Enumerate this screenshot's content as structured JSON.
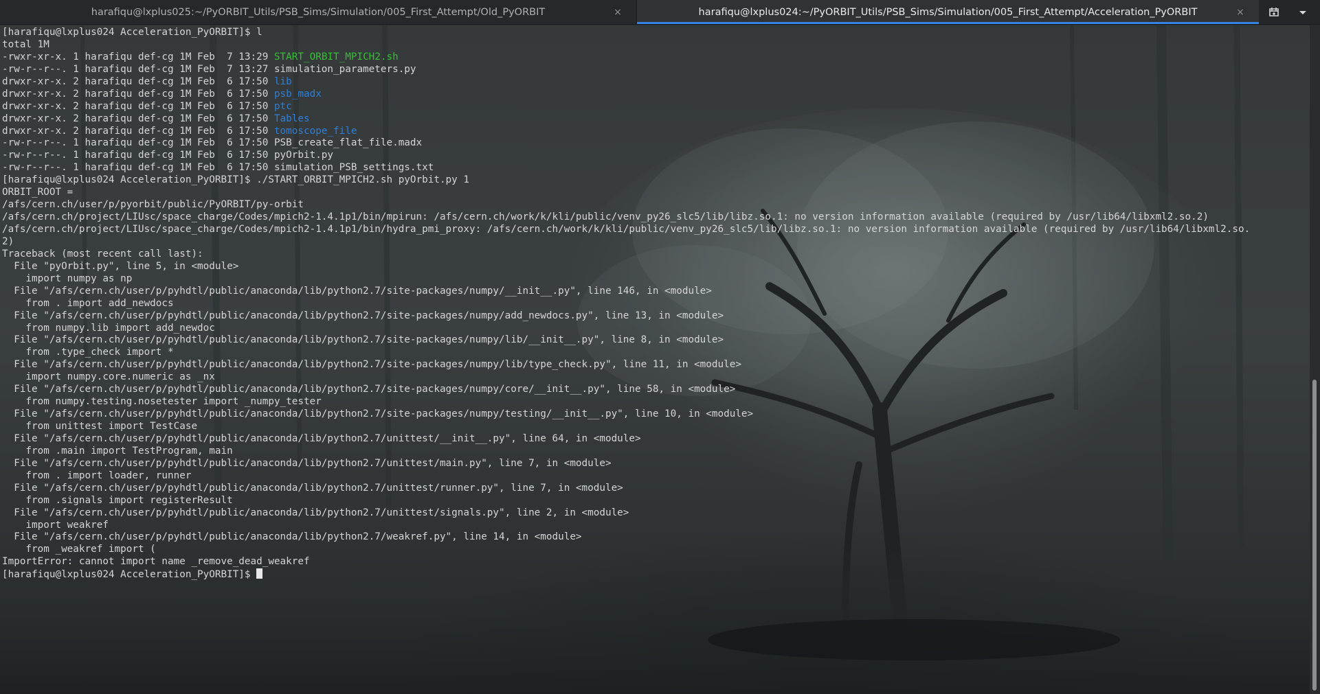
{
  "tabs": [
    {
      "title": "harafiqu@lxplus025:~/PyORBIT_Utils/PSB_Sims/Simulation/005_First_Attempt/Old_PyORBIT",
      "active": false,
      "close_glyph": "×"
    },
    {
      "title": "harafiqu@lxplus024:~/PyORBIT_Utils/PSB_Sims/Simulation/005_First_Attempt/Acceleration_PyORBIT",
      "active": true,
      "close_glyph": "×"
    }
  ],
  "toolbar": {
    "new_tab_icon": "new-tab-icon",
    "menu_icon": "chevron-down-icon"
  },
  "colors": {
    "tab_active_underline": "#3584e4",
    "executable": "#33c233",
    "directory": "#2f7fd8",
    "text": "#d4d6d6"
  },
  "terminal": {
    "lines": [
      [
        {
          "t": "[harafiqu@lxplus024 Acceleration_PyORBIT]$ l"
        }
      ],
      [
        {
          "t": "total 1M"
        }
      ],
      [
        {
          "t": "-rwxr-xr-x. 1 harafiqu def-cg 1M Feb  7 13:29 "
        },
        {
          "t": "START_ORBIT_MPICH2.sh",
          "c": "exec"
        }
      ],
      [
        {
          "t": "-rw-r--r--. 1 harafiqu def-cg 1M Feb  7 13:27 simulation_parameters.py"
        }
      ],
      [
        {
          "t": "drwxr-xr-x. 2 harafiqu def-cg 1M Feb  6 17:50 "
        },
        {
          "t": "lib",
          "c": "dir"
        }
      ],
      [
        {
          "t": "drwxr-xr-x. 2 harafiqu def-cg 1M Feb  6 17:50 "
        },
        {
          "t": "psb_madx",
          "c": "dir"
        }
      ],
      [
        {
          "t": "drwxr-xr-x. 2 harafiqu def-cg 1M Feb  6 17:50 "
        },
        {
          "t": "ptc",
          "c": "dir"
        }
      ],
      [
        {
          "t": "drwxr-xr-x. 2 harafiqu def-cg 1M Feb  6 17:50 "
        },
        {
          "t": "Tables",
          "c": "dir"
        }
      ],
      [
        {
          "t": "drwxr-xr-x. 2 harafiqu def-cg 1M Feb  6 17:50 "
        },
        {
          "t": "tomoscope_file",
          "c": "dir"
        }
      ],
      [
        {
          "t": "-rw-r--r--. 1 harafiqu def-cg 1M Feb  6 17:50 PSB_create_flat_file.madx"
        }
      ],
      [
        {
          "t": "-rw-r--r--. 1 harafiqu def-cg 1M Feb  6 17:50 pyOrbit.py"
        }
      ],
      [
        {
          "t": "-rw-r--r--. 1 harafiqu def-cg 1M Feb  6 17:50 simulation_PSB_settings.txt"
        }
      ],
      [
        {
          "t": "[harafiqu@lxplus024 Acceleration_PyORBIT]$ ./START_ORBIT_MPICH2.sh pyOrbit.py 1"
        }
      ],
      [
        {
          "t": "ORBIT_ROOT ="
        }
      ],
      [
        {
          "t": "/afs/cern.ch/user/p/pyorbit/public/PyORBIT/py-orbit"
        }
      ],
      [
        {
          "t": "/afs/cern.ch/project/LIUsc/space_charge/Codes/mpich2-1.4.1p1/bin/mpirun: /afs/cern.ch/work/k/kli/public/venv_py26_slc5/lib/libz.so.1: no version information available (required by /usr/lib64/libxml2.so.2)"
        }
      ],
      [
        {
          "t": "/afs/cern.ch/project/LIUsc/space_charge/Codes/mpich2-1.4.1p1/bin/hydra_pmi_proxy: /afs/cern.ch/work/k/kli/public/venv_py26_slc5/lib/libz.so.1: no version information available (required by /usr/lib64/libxml2.so."
        }
      ],
      [
        {
          "t": "2)"
        }
      ],
      [
        {
          "t": "Traceback (most recent call last):"
        }
      ],
      [
        {
          "t": "  File \"pyOrbit.py\", line 5, in <module>"
        }
      ],
      [
        {
          "t": "    import numpy as np"
        }
      ],
      [
        {
          "t": "  File \"/afs/cern.ch/user/p/pyhdtl/public/anaconda/lib/python2.7/site-packages/numpy/__init__.py\", line 146, in <module>"
        }
      ],
      [
        {
          "t": "    from . import add_newdocs"
        }
      ],
      [
        {
          "t": "  File \"/afs/cern.ch/user/p/pyhdtl/public/anaconda/lib/python2.7/site-packages/numpy/add_newdocs.py\", line 13, in <module>"
        }
      ],
      [
        {
          "t": "    from numpy.lib import add_newdoc"
        }
      ],
      [
        {
          "t": "  File \"/afs/cern.ch/user/p/pyhdtl/public/anaconda/lib/python2.7/site-packages/numpy/lib/__init__.py\", line 8, in <module>"
        }
      ],
      [
        {
          "t": "    from .type_check import *"
        }
      ],
      [
        {
          "t": "  File \"/afs/cern.ch/user/p/pyhdtl/public/anaconda/lib/python2.7/site-packages/numpy/lib/type_check.py\", line 11, in <module>"
        }
      ],
      [
        {
          "t": "    import numpy.core.numeric as _nx"
        }
      ],
      [
        {
          "t": "  File \"/afs/cern.ch/user/p/pyhdtl/public/anaconda/lib/python2.7/site-packages/numpy/core/__init__.py\", line 58, in <module>"
        }
      ],
      [
        {
          "t": "    from numpy.testing.nosetester import _numpy_tester"
        }
      ],
      [
        {
          "t": "  File \"/afs/cern.ch/user/p/pyhdtl/public/anaconda/lib/python2.7/site-packages/numpy/testing/__init__.py\", line 10, in <module>"
        }
      ],
      [
        {
          "t": "    from unittest import TestCase"
        }
      ],
      [
        {
          "t": "  File \"/afs/cern.ch/user/p/pyhdtl/public/anaconda/lib/python2.7/unittest/__init__.py\", line 64, in <module>"
        }
      ],
      [
        {
          "t": "    from .main import TestProgram, main"
        }
      ],
      [
        {
          "t": "  File \"/afs/cern.ch/user/p/pyhdtl/public/anaconda/lib/python2.7/unittest/main.py\", line 7, in <module>"
        }
      ],
      [
        {
          "t": "    from . import loader, runner"
        }
      ],
      [
        {
          "t": "  File \"/afs/cern.ch/user/p/pyhdtl/public/anaconda/lib/python2.7/unittest/runner.py\", line 7, in <module>"
        }
      ],
      [
        {
          "t": "    from .signals import registerResult"
        }
      ],
      [
        {
          "t": "  File \"/afs/cern.ch/user/p/pyhdtl/public/anaconda/lib/python2.7/unittest/signals.py\", line 2, in <module>"
        }
      ],
      [
        {
          "t": "    import weakref"
        }
      ],
      [
        {
          "t": "  File \"/afs/cern.ch/user/p/pyhdtl/public/anaconda/lib/python2.7/weakref.py\", line 14, in <module>"
        }
      ],
      [
        {
          "t": "    from _weakref import ("
        }
      ],
      [
        {
          "t": "ImportError: cannot import name _remove_dead_weakref"
        }
      ],
      [
        {
          "t": "[harafiqu@lxplus024 Acceleration_PyORBIT]$ ",
          "cursor": true
        }
      ]
    ]
  },
  "scrollbar": {
    "thumb_start_fraction": 0.53,
    "thumb_end_fraction": 0.995
  }
}
